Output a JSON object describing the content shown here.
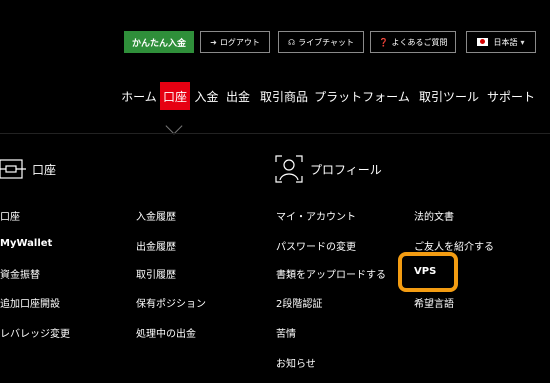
{
  "topbar": {
    "deposit_label": "かんたん入金",
    "logout_label": "ログアウト",
    "livechat_label": "ライブチャット",
    "faq_label": "よくあるご質問",
    "language_label": "日本語"
  },
  "nav": {
    "items": [
      "ホーム",
      "口座",
      "入金",
      "出金",
      "取引商品",
      "プラットフォーム",
      "取引ツール",
      "サポート"
    ],
    "active": "口座"
  },
  "account_section": {
    "title": "口座",
    "col1": [
      "口座",
      "MyWallet",
      "資金振替",
      "追加口座開設",
      "レバレッジ変更"
    ],
    "col2": [
      "入金履歴",
      "出金履歴",
      "取引履歴",
      "保有ポジション",
      "処理中の出金"
    ]
  },
  "profile_section": {
    "title": "プロフィール",
    "col1": [
      "マイ・アカウント",
      "パスワードの変更",
      "書類をアップロードする",
      "2段階認証",
      "苦情",
      "お知らせ"
    ],
    "col2": [
      "法的文書",
      "ご友人を紹介する",
      "VPS",
      "希望言語"
    ]
  },
  "colors": {
    "active": "#e60012",
    "deposit": "#2f8f3a",
    "highlight": "#f39c12"
  }
}
